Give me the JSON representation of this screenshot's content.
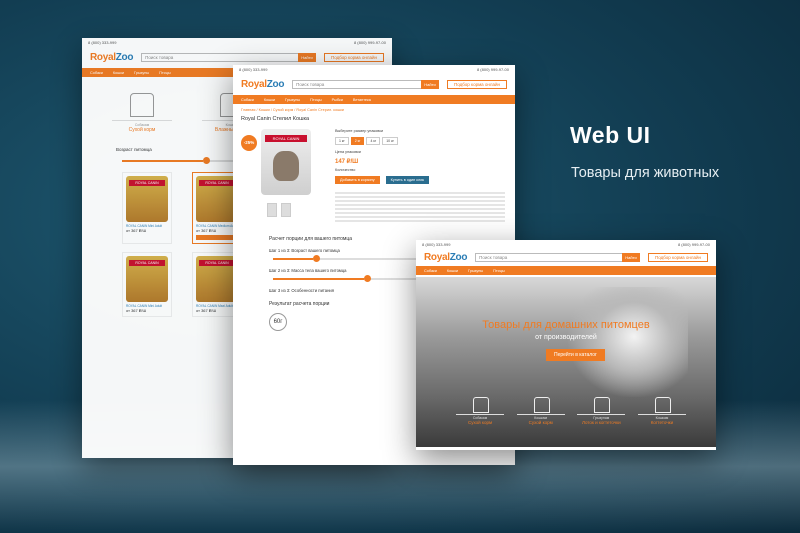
{
  "brand": {
    "logo_royal": "Royal",
    "logo_zoo": "Zoo",
    "accent": "#f07b22",
    "blue": "#2a7db5"
  },
  "header": {
    "phone1": "8 (800) 333-999",
    "phone2": "8 (800) 999-97-00",
    "search_placeholder": "Поиск товара",
    "search_button": "Найти",
    "pick_food_button": "Подбор корма онлайн"
  },
  "nav": {
    "items": [
      "Собаки",
      "Кошки",
      "Грызуны",
      "Птицы",
      "Рыбки",
      "Ветаптека"
    ]
  },
  "screen1": {
    "categories": [
      {
        "small": "Собакам",
        "label": "Сухой корм"
      },
      {
        "small": "Кошкам",
        "label": "Влажный корм"
      }
    ],
    "section_label": "Возраст питомца",
    "products": [
      {
        "name": "ROYAL CANIN Mini Adult",
        "price": "от 367 ₽/Ш"
      },
      {
        "name": "ROYAL CANIN Medium Adult",
        "price": "от 367 ₽/Ш"
      },
      {
        "name": "ROYAL CANIN Mini Adult",
        "price": "от 367 ₽/Ш"
      },
      {
        "name": "ROYAL CANIN Maxi Adult",
        "price": "от 367 ₽/Ш"
      }
    ]
  },
  "screen2": {
    "breadcrumbs": "Главная / Кошки / Сухой корм / Royal Canin Стерил. кошки",
    "title": "Royal Canin Стелил Кошка",
    "discount_badge": "-25%",
    "choose_size": "Выберите размер упаковки",
    "sizes": [
      "1 кг",
      "2 кг",
      "4 кг",
      "10 кг"
    ],
    "price_label": "Цена упаковки",
    "price": "147 ₽/Ш",
    "qty_label": "Количество",
    "add_button": "Добавить в корзину",
    "buy_button": "Купить в один клик",
    "calc_title": "Расчет порции для вашего питомца",
    "step1": "Шаг 1 из 3: Возраст вашего питомца",
    "step2": "Шаг 2 из 3: Масса тела вашего питомца",
    "step3": "Шаг 3 из 3: Особенности питания",
    "result_title": "Результат расчета порции",
    "result_value": "60г"
  },
  "screen3": {
    "hero_title": "Товары для домашних питомцев",
    "hero_subtitle": "от производителей",
    "hero_button": "Перейти в каталог",
    "categories": [
      {
        "small": "Собакам",
        "label": "Сухой корм"
      },
      {
        "small": "Кошкам",
        "label": "Сухой корм"
      },
      {
        "small": "Грызунам",
        "label": "Лоток и когтеточки"
      },
      {
        "small": "Кошкам",
        "label": "Когтеточки"
      }
    ]
  },
  "promo": {
    "headline": "Web UI",
    "subline": "Товары для животных"
  }
}
